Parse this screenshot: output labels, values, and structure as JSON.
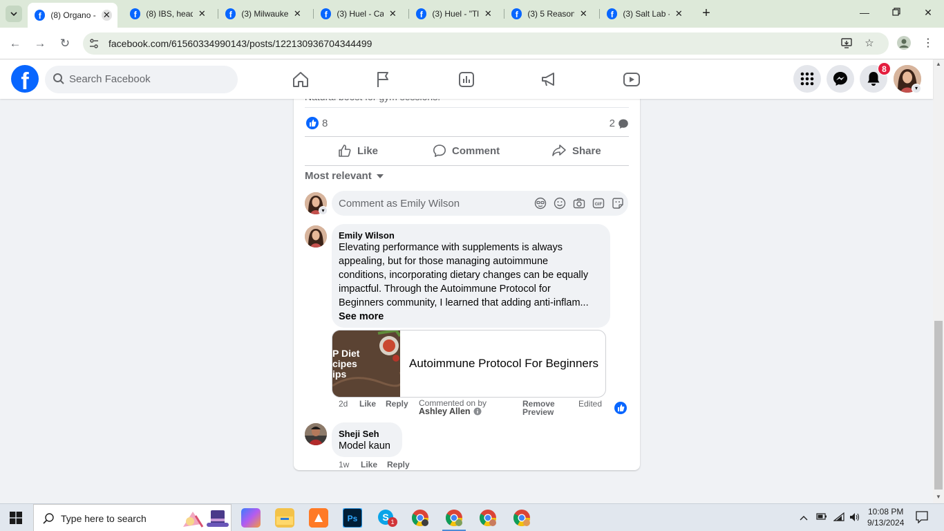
{
  "browser": {
    "tabs": [
      {
        "title": "(8) Organo -",
        "active": true
      },
      {
        "title": "(8) IBS, head",
        "active": false
      },
      {
        "title": "(3) Milwauke",
        "active": false
      },
      {
        "title": "(3) Huel - Ca",
        "active": false
      },
      {
        "title": "(3) Huel - \"Tl",
        "active": false
      },
      {
        "title": "(3) 5 Reason",
        "active": false
      },
      {
        "title": "(3) Salt Lab -",
        "active": false
      }
    ],
    "url": "facebook.com/61560334990143/posts/122130936704344499"
  },
  "facebook": {
    "search_placeholder": "Search Facebook",
    "notification_count": "8"
  },
  "post": {
    "clipped_text": "Natural boost for gym sessions.",
    "like_count": "8",
    "comment_count": "2",
    "actions": {
      "like": "Like",
      "comment": "Comment",
      "share": "Share"
    },
    "sort_label": "Most relevant",
    "comment_placeholder": "Comment as Emily Wilson"
  },
  "comments": [
    {
      "author": "Emily Wilson",
      "lines": [
        "Elevating performance with supplements is always",
        "appealing, but for those managing autoimmune",
        "conditions, incorporating dietary changes can be equally",
        "impactful. Through the Autoimmune Protocol for",
        "Beginners community, I learned that adding anti-inflam..."
      ],
      "see_more": "See more",
      "preview_title": "Autoimmune Protocol For Beginners",
      "preview_image_text": [
        "P Diet",
        "cipes",
        "ips"
      ],
      "time": "2d",
      "like": "Like",
      "reply": "Reply",
      "commented_on_by": "Commented on by",
      "commented_by_name": "Ashley Allen",
      "remove_preview_line1": "Remove",
      "remove_preview_line2": "Preview",
      "edited": "Edited"
    },
    {
      "author": "Sheji Seh",
      "text": "Model kaun",
      "time": "1w",
      "like": "Like",
      "reply": "Reply"
    }
  ],
  "taskbar": {
    "search_placeholder": "Type here to search",
    "time": "10:08 PM",
    "date": "9/13/2024",
    "skype_badge": "1"
  },
  "colors": {
    "facebook_blue": "#0866ff",
    "badge_red": "#e41e3f"
  }
}
